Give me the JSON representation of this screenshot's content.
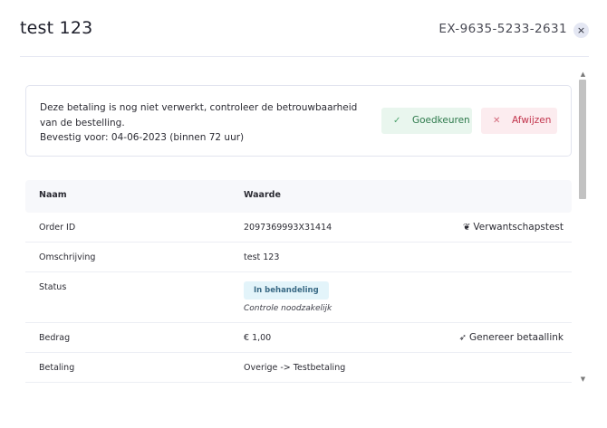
{
  "header": {
    "title": "test 123",
    "reference": "EX-9635-5233-2631",
    "close_glyph": "×"
  },
  "alert": {
    "line1": "Deze betaling is nog niet verwerkt, controleer de betrouwbaarheid van de bestelling.",
    "line2": "Bevestig voor: 04-06-2023 (binnen 72 uur)",
    "approve": {
      "label": "Goedkeuren",
      "icon": "check-icon",
      "glyph": "✓",
      "color": "#2e7a4c"
    },
    "reject": {
      "label": "Afwijzen",
      "icon": "x-icon",
      "glyph": "✕",
      "color": "#c2344c"
    }
  },
  "table": {
    "columns": [
      "Naam",
      "Waarde"
    ],
    "rows": [
      {
        "name": "Order ID",
        "value": "2097369993X31414",
        "action": "Verwantschapstest",
        "action_icon": "dna-icon",
        "action_glyph": "❦"
      },
      {
        "name": "Omschrijving",
        "value": "test 123"
      },
      {
        "name": "Status",
        "badge": "In behandeling",
        "note": "Controle noodzakelijk",
        "badge_color": "#e3f4fa"
      },
      {
        "name": "Bedrag",
        "value": "€ 1,00",
        "action": "Genereer betaallink",
        "action_icon": "send-icon",
        "action_glyph": "➶"
      },
      {
        "name": "Betaling",
        "value": "Overige -> Testbetaling"
      }
    ]
  },
  "scrollbar": {
    "up_glyph": "▲",
    "down_glyph": "▼"
  }
}
